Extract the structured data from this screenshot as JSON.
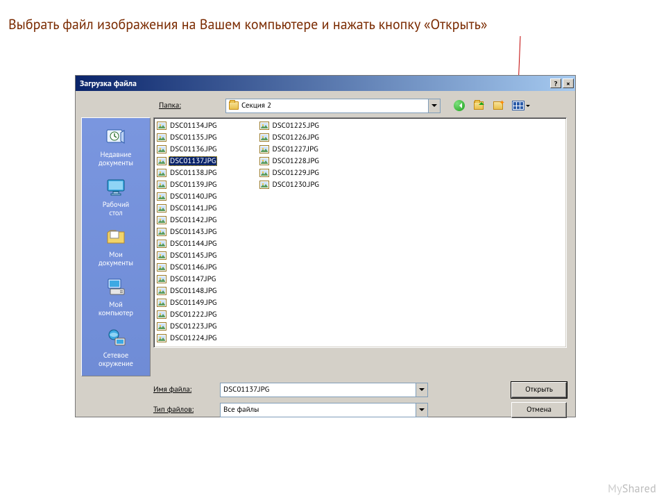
{
  "instruction": "Выбрать файл изображения на Вашем компьютере и нажать кнопку «Открыть»",
  "dialog": {
    "title": "Загрузка файла",
    "help_btn": "?",
    "close_btn": "×",
    "folder_label": "Папка:",
    "folder_value": "Секция 2",
    "filename_label": "Имя файла:",
    "filename_value": "DSC01137.JPG",
    "filetype_label": "Тип файлов:",
    "filetype_value": "Все файлы",
    "open_btn": "Открыть",
    "cancel_btn": "Отмена"
  },
  "places": [
    {
      "label": "Недавние документы",
      "icon": "recent"
    },
    {
      "label": "Рабочий стол",
      "icon": "desktop"
    },
    {
      "label": "Мои документы",
      "icon": "mydocs"
    },
    {
      "label": "Мой компьютер",
      "icon": "mycomputer"
    },
    {
      "label": "Сетевое окружение",
      "icon": "network"
    }
  ],
  "files": {
    "selected": "DSC01137.JPG",
    "col1": [
      "DSC01134.JPG",
      "DSC01135.JPG",
      "DSC01136.JPG",
      "DSC01137.JPG",
      "DSC01138.JPG",
      "DSC01139.JPG",
      "DSC01140.JPG",
      "DSC01141.JPG",
      "DSC01142.JPG",
      "DSC01143.JPG",
      "DSC01144.JPG",
      "DSC01145.JPG",
      "DSC01146.JPG",
      "DSC01147.JPG",
      "DSC01148.JPG"
    ],
    "col2": [
      "DSC01149.JPG",
      "DSC01222.JPG",
      "DSC01223.JPG",
      "DSC01224.JPG",
      "DSC01225.JPG",
      "DSC01226.JPG",
      "DSC01227.JPG",
      "DSC01228.JPG",
      "DSC01229.JPG",
      "DSC01230.JPG"
    ]
  },
  "watermark": {
    "a": "My",
    "b": "Shared"
  }
}
